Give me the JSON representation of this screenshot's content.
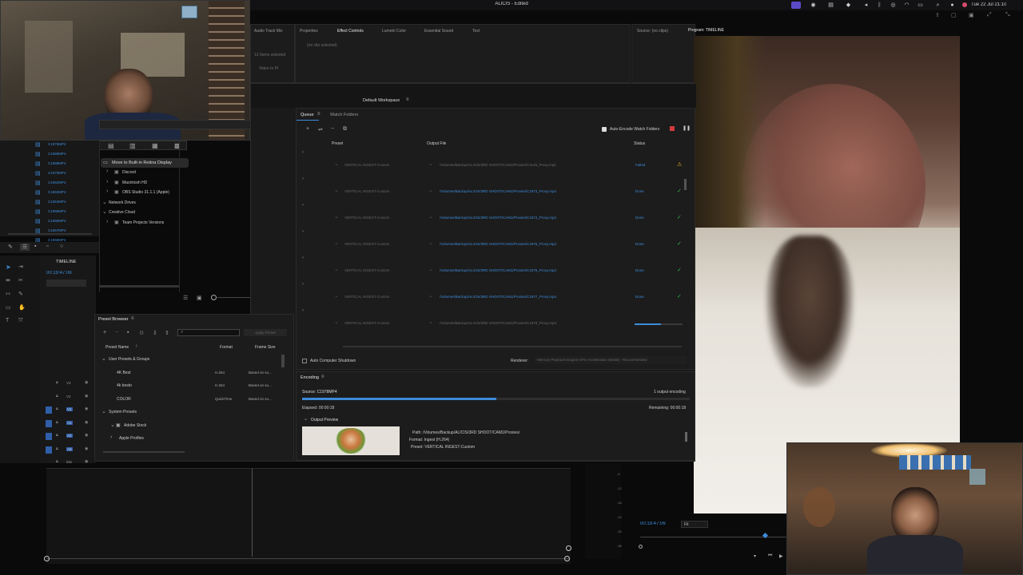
{
  "app_title": "ALICIS - Edited",
  "menubar": {
    "clock": "Tue 22 Jul 21:10"
  },
  "top_tabs": {
    "audio_track_mixer": "Audio Track Mix",
    "properties": "Properties",
    "effect_controls": "Effect Controls",
    "lumetri": "Lumetri Color",
    "essential_sound": "Essential Sound",
    "text": "Text",
    "source": "Source: (no clips)",
    "program": "Program: TIMELINE",
    "no_clip": "(no clip selected)"
  },
  "project": {
    "items_selected": "12 Items selected",
    "video_in": "Video In Pt"
  },
  "files": [
    "C1976MP4",
    "C1969MP4",
    "C1968MP4",
    "C1970MP4",
    "C1962MP4",
    "C1963MP4",
    "C1964MP4",
    "C1965MP4",
    "C1966MP4",
    "C1967MP4",
    "C1968MP4"
  ],
  "popup": {
    "move_label": "Move to Built-in Retina Display"
  },
  "drives": {
    "items": [
      {
        "label": "Discord",
        "indent": 1
      },
      {
        "label": "Macintosh HD",
        "indent": 1
      },
      {
        "label": "OBS Studio 31.1.1 (Apple)",
        "indent": 1
      },
      {
        "label": "Network Drives",
        "indent": 0
      },
      {
        "label": "Creative Cloud",
        "indent": 0
      },
      {
        "label": "Team Projects Versions",
        "indent": 1
      }
    ]
  },
  "timeline": {
    "name": "TIMELINE",
    "timecode": "00:19:47:06"
  },
  "encoder": {
    "workspace": "Default Workspace",
    "tab_queue": "Queue",
    "tab_watch": "Watch Folders",
    "auto_encode": "Auto-Encode Watch Folders",
    "col_preset": "Preset",
    "col_output": "Output File",
    "col_status": "Status",
    "rows": [
      {
        "preset": "VERTICAL INGEST-Custom",
        "output": "/Volumes/Backup/ALICIS/3RD SHOOT/CAM1/Proxies/C1149_Proxy.mp4",
        "status": "Failed",
        "icon": "⚠"
      },
      {
        "preset": "VERTICAL INGEST-Custom",
        "output": "/Volumes/Backup/ALICIS/3RD SHOOT/CAM1/Proxies/C1973_Proxy.mp4",
        "status": "Done",
        "icon": "✓"
      },
      {
        "preset": "VERTICAL INGEST-Custom",
        "output": "/Volumes/Backup/ALICIS/3RD SHOOT/CAM1/Proxies/C1974_Proxy.mp4",
        "status": "Done",
        "icon": "✓"
      },
      {
        "preset": "VERTICAL INGEST-Custom",
        "output": "/Volumes/Backup/ALICIS/3RD SHOOT/CAM1/Proxies/C1975_Proxy.mp4",
        "status": "Done",
        "icon": "✓"
      },
      {
        "preset": "VERTICAL INGEST-Custom",
        "output": "/Volumes/Backup/ALICIS/3RD SHOOT/CAM1/Proxies/C1976_Proxy.mp4",
        "status": "Done",
        "icon": "✓"
      },
      {
        "preset": "VERTICAL INGEST-Custom",
        "output": "/Volumes/Backup/ALICIS/3RD SHOOT/CAM1/Proxies/C1977_Proxy.mp4",
        "status": "Done",
        "icon": "✓"
      },
      {
        "preset": "VERTICAL INGEST-Custom",
        "output": "/Volumes/Backup/ALICIS/3RD SHOOT/CAM1/Proxies/C1978_Proxy.mp4",
        "status": "",
        "icon": "",
        "progress": 0.55
      }
    ],
    "auto_shutdown": "Auto Computer Shutdown",
    "renderer_label": "Renderer:",
    "renderer_value": "Mercury Playback Engine GPU Acceleration (Metal) - Recommended"
  },
  "encoding": {
    "tab": "Encoding",
    "source": "Source: C1978MP4",
    "output_count": "1 output encoding",
    "elapsed": "Elapsed: 00:00:18",
    "remaining": "Remaining: 00:00:18",
    "progress": 0.5,
    "output_preview": "Output Preview",
    "path": "Path: /Volumes/Backup/ALICIS/3RD SHOOT/CAM1/Proxies/",
    "format": "Format: Ingest (H.264)",
    "preset": "Preset: VERTICAL INGEST-Custom"
  },
  "preset_browser": {
    "title": "Preset Browser",
    "apply_preset": "Apply Preset",
    "col_name": "Preset Name",
    "col_format": "Format",
    "col_size": "Frame Size",
    "rows": [
      {
        "name": "User Presets & Groups",
        "format": "",
        "size": "",
        "group": true
      },
      {
        "name": "4K Best",
        "format": "H.264",
        "size": "Based on so..."
      },
      {
        "name": "4k besto",
        "format": "H.264",
        "size": "Based on so..."
      },
      {
        "name": "COLOR",
        "format": "QuickTime",
        "size": "Based on so..."
      },
      {
        "name": "System Presets",
        "format": "",
        "size": "",
        "group": true
      },
      {
        "name": "Adobe Stock",
        "format": "",
        "size": "",
        "group": true
      },
      {
        "name": "Apple Profiles",
        "format": "",
        "size": "",
        "group": true
      }
    ]
  },
  "program_monitor": {
    "timecode": "00:19:47:06",
    "fit": "Fit"
  },
  "tracks": [
    "V3",
    "V2",
    "V1",
    "A1",
    "A2",
    "A3",
    "Mix"
  ],
  "colors": {
    "accent": "#3d8bd9",
    "done": "#2bbf4e",
    "failed_icon": "#e6b422"
  }
}
